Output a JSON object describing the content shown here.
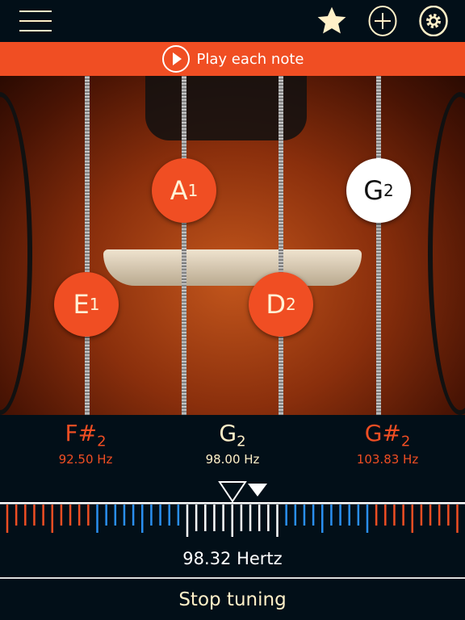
{
  "header": {
    "icons": [
      "menu-icon",
      "star-icon",
      "add-icon",
      "settings-icon"
    ]
  },
  "banner": {
    "label": "Play each note"
  },
  "strings": [
    {
      "note": "E",
      "octave": "1",
      "selected": false
    },
    {
      "note": "A",
      "octave": "1",
      "selected": false
    },
    {
      "note": "D",
      "octave": "2",
      "selected": false
    },
    {
      "note": "G",
      "octave": "2",
      "selected": true
    }
  ],
  "tuner": {
    "prev": {
      "note": "F#",
      "octave": "2",
      "freq": "92.50 Hz"
    },
    "target": {
      "note": "G",
      "octave": "2",
      "freq": "98.00 Hz"
    },
    "next": {
      "note": "G#",
      "octave": "2",
      "freq": "103.83 Hz"
    },
    "reading": "98.32 Hertz"
  },
  "stop_label": "Stop tuning",
  "colors": {
    "accent": "#f04e23",
    "cream": "#fff0c8",
    "blue": "#2a8ff0",
    "bg": "#020f18"
  }
}
